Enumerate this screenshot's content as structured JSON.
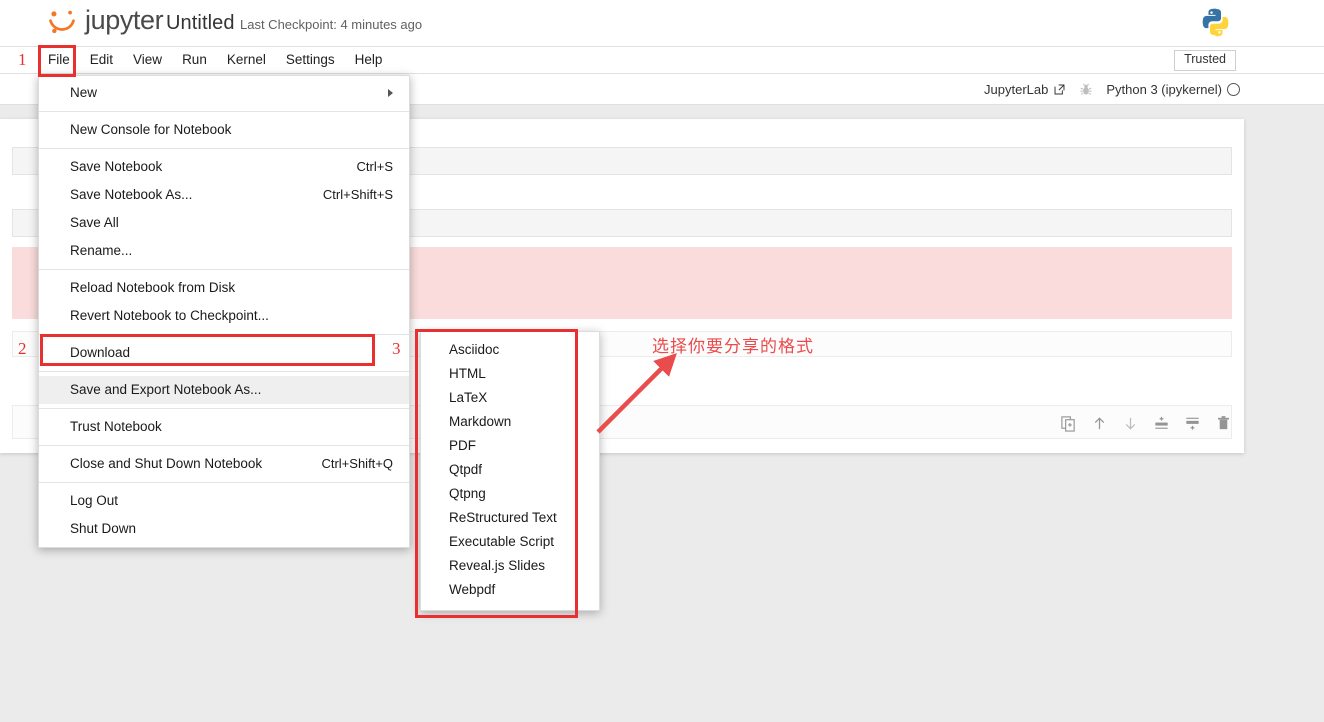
{
  "colors": {
    "annotation_red": "#e83030",
    "annotation_text_red": "#ea4b4b",
    "jupyter_orange": "#f37726",
    "error_cell_pink": "#fadcdc",
    "cell_gray": "#f5f5f5",
    "panel_gray": "#ebebeb"
  },
  "topbar": {
    "logo_icon": "jupyter-logo",
    "brand": "jupyter",
    "notebook_title": "Untitled",
    "checkpoint": "Last Checkpoint: 4 minutes ago",
    "python_logo_icon": "python-logo"
  },
  "menubar": {
    "items": [
      {
        "label": "File"
      },
      {
        "label": "Edit"
      },
      {
        "label": "View"
      },
      {
        "label": "Run"
      },
      {
        "label": "Kernel"
      },
      {
        "label": "Settings"
      },
      {
        "label": "Help"
      }
    ],
    "trusted_badge": "Trusted"
  },
  "kernelbar": {
    "jupyterlab_label": "JupyterLab",
    "jupyterlab_icon": "external-link-icon",
    "debug_icon": "bug-icon",
    "kernel_name": "Python 3 (ipykernel)",
    "kernel_status_icon": "kernel-idle-circle-icon"
  },
  "file_menu": {
    "groups": [
      [
        {
          "label": "New",
          "shortcut": "",
          "submenu": true
        }
      ],
      [
        {
          "label": "New Console for Notebook",
          "shortcut": "",
          "submenu": false
        }
      ],
      [
        {
          "label": "Save Notebook",
          "shortcut": "Ctrl+S",
          "submenu": false
        },
        {
          "label": "Save Notebook As...",
          "shortcut": "Ctrl+Shift+S",
          "submenu": false
        },
        {
          "label": "Save All",
          "shortcut": "",
          "submenu": false
        },
        {
          "label": "Rename...",
          "shortcut": "",
          "submenu": false
        }
      ],
      [
        {
          "label": "Reload Notebook from Disk",
          "shortcut": "",
          "submenu": false
        },
        {
          "label": "Revert Notebook to Checkpoint...",
          "shortcut": "",
          "submenu": false
        }
      ],
      [
        {
          "label": "Download",
          "shortcut": "",
          "submenu": false
        }
      ],
      [
        {
          "label": "Save and Export Notebook As...",
          "shortcut": "",
          "submenu": false,
          "active": true
        }
      ],
      [
        {
          "label": "Trust Notebook",
          "shortcut": "",
          "submenu": false
        }
      ],
      [
        {
          "label": "Close and Shut Down Notebook",
          "shortcut": "Ctrl+Shift+Q",
          "submenu": false
        }
      ],
      [
        {
          "label": "Log Out",
          "shortcut": "",
          "submenu": false
        },
        {
          "label": "Shut Down",
          "shortcut": "",
          "submenu": false
        }
      ]
    ]
  },
  "export_submenu": {
    "items": [
      {
        "label": "Asciidoc"
      },
      {
        "label": "HTML"
      },
      {
        "label": "LaTeX"
      },
      {
        "label": "Markdown"
      },
      {
        "label": "PDF"
      },
      {
        "label": "Qtpdf"
      },
      {
        "label": "Qtpng"
      },
      {
        "label": "ReStructured Text"
      },
      {
        "label": "Executable Script"
      },
      {
        "label": "Reveal.js Slides"
      },
      {
        "label": "Webpdf"
      }
    ]
  },
  "cell_toolbar": {
    "icons": [
      "duplicate-cell-icon",
      "move-cell-up-icon",
      "move-cell-down-icon",
      "insert-cell-above-icon",
      "insert-cell-below-icon",
      "delete-cell-icon"
    ]
  },
  "annotations": {
    "step1": "1",
    "step2": "2",
    "step3": "3",
    "note_cn": "选择你要分享的格式"
  }
}
